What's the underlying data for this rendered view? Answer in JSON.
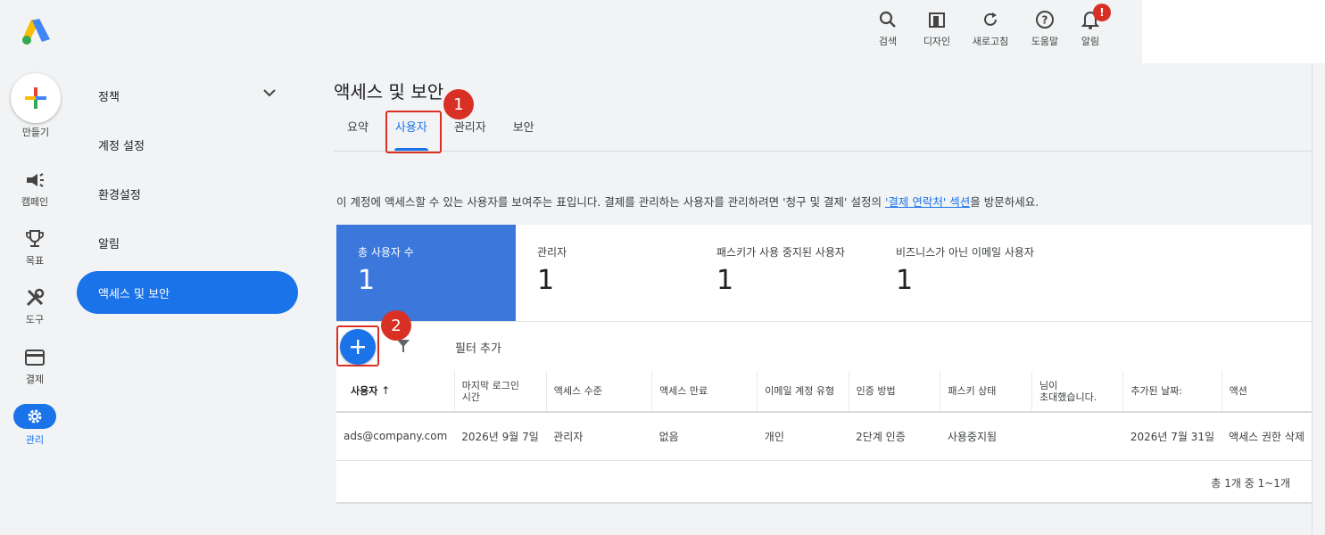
{
  "topbar": {
    "search_label": "검색",
    "design_label": "디자인",
    "refresh_label": "새로고침",
    "help_label": "도움말",
    "notifications_label": "알림",
    "notifications_badge": "!"
  },
  "rail": {
    "create_label": "만들기",
    "campaigns_label": "캠페인",
    "goals_label": "목표",
    "tools_label": "도구",
    "billing_label": "결제",
    "admin_label": "관리"
  },
  "subnav": {
    "items": [
      {
        "label": "정책"
      },
      {
        "label": "계정 설정"
      },
      {
        "label": "환경설정"
      },
      {
        "label": "알림"
      },
      {
        "label": "액세스 및 보안"
      }
    ]
  },
  "main": {
    "title": "액세스 및 보안",
    "tabs": [
      {
        "label": "요약"
      },
      {
        "label": "사용자"
      },
      {
        "label": "관리자"
      },
      {
        "label": "보안"
      }
    ],
    "description_pre": "이 계정에 액세스할 수 있는 사용자를 보여주는 표입니다. 결제를 관리하는 사용자를 관리하려면 '청구 및 결제' 설정의 ",
    "description_link": "'결제 연락처' 섹션",
    "description_post": "을 방문하세요.",
    "stats": [
      {
        "label": "총 사용자 수",
        "value": "1"
      },
      {
        "label": "관리자",
        "value": "1"
      },
      {
        "label": "패스키가 사용 중지된 사용자",
        "value": "1"
      },
      {
        "label": "비즈니스가 아닌 이메일 사용자",
        "value": "1"
      }
    ],
    "filter_label": "필터 추가",
    "callouts": {
      "one": "1",
      "two": "2"
    }
  },
  "table": {
    "headers": {
      "user": "사용자",
      "last_login_1": "마지막 로그인",
      "last_login_2": "시간",
      "access_level": "액세스 수준",
      "access_expiry": "액세스 만료",
      "email_type": "이메일 계정 유형",
      "auth_method": "인증 방법",
      "passkey_status": "패스키 상태",
      "invited_by_1": "님이",
      "invited_by_2": "초대했습니다.",
      "date_added": "추가된 날짜:",
      "action": "액션"
    },
    "rows": [
      {
        "user": "ads@company.com",
        "last_login": "2026년 9월 7일",
        "access_level": "관리자",
        "access_expiry": "없음",
        "email_type": "개인",
        "auth_method": "2단계 인증",
        "passkey_status": "사용중지됨",
        "invited_by": "",
        "date_added": "2026년 7월 31일",
        "action": "액세스 권한 삭제"
      }
    ],
    "pagination": "총 1개 중 1~1개"
  }
}
